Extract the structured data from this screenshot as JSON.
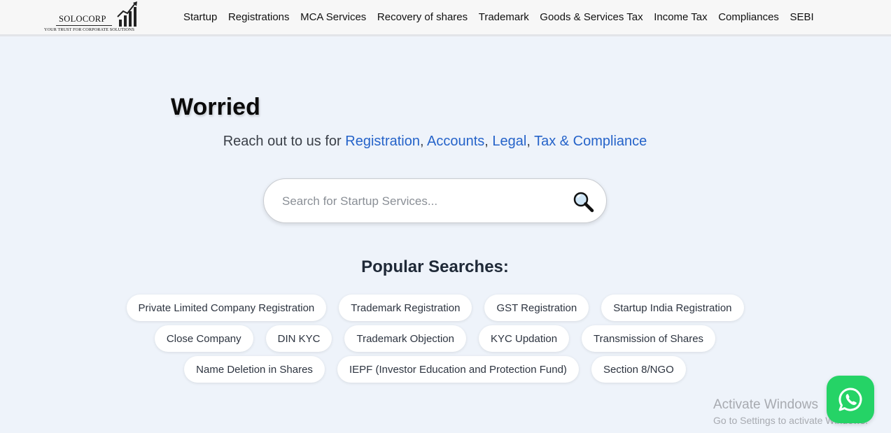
{
  "header": {
    "logo_name": "SOLOCORP",
    "logo_tagline": "YOUR TRUST FOR CORPORATE SOLUTIONS",
    "nav": [
      "Startup",
      "Registrations",
      "MCA Services",
      "Recovery of shares",
      "Trademark",
      "Goods & Services Tax",
      "Income Tax",
      "Compliances",
      "SEBI"
    ]
  },
  "hero": {
    "headline": "Worried",
    "tagline_prefix": "Reach out to us for ",
    "highlight_1": "Registration",
    "sep_1": ", ",
    "highlight_2": "Accounts",
    "sep_2": ", ",
    "highlight_3": "Legal",
    "sep_3": ", ",
    "highlight_4": "Tax & Compliance"
  },
  "search": {
    "placeholder": "Search for Startup Services...",
    "value": "",
    "icon": "magnifier-icon"
  },
  "popular": {
    "title": "Popular Searches:",
    "row1": [
      "Private Limited Company Registration",
      "Trademark Registration",
      "GST Registration",
      "Startup India Registration"
    ],
    "row2": [
      "Close Company",
      "DIN KYC",
      "Trademark Objection",
      "KYC Updation",
      "Transmission of Shares"
    ],
    "row3": [
      "Name Deletion in Shares",
      "IEPF (Investor Education and Protection Fund)",
      "Section 8/NGO"
    ]
  },
  "watermark": {
    "title": "Activate Windows",
    "subtitle": "Go to Settings to activate Windows."
  },
  "colors": {
    "accent": "#2563c9",
    "background": "#eef3fa",
    "whatsapp": "#25d366"
  }
}
